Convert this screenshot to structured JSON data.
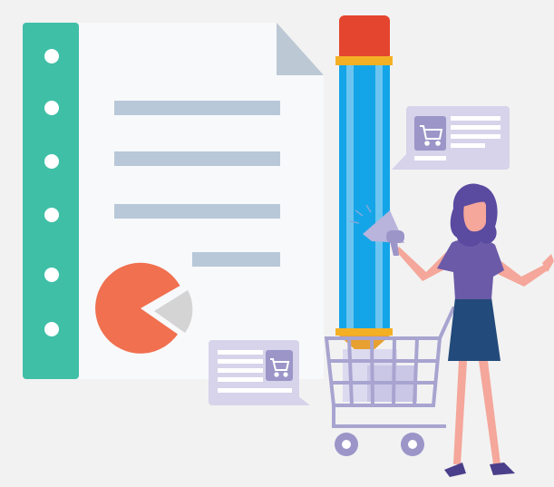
{
  "colors": {
    "background": "#f2f2f2",
    "paper": "#f8f9fb",
    "paper_fold": "#bcc8d4",
    "binder_strip": "#3fbfa6",
    "binder_hole": "#ffffff",
    "text_lines": "#b8c8d8",
    "pie_main": "#f0704f",
    "pie_slice": "#d4d4d4",
    "pencil_eraser": "#e4452f",
    "pencil_band": "#f4b024",
    "pencil_body": "#14a5e8",
    "pencil_stripe": "#6bc5f0",
    "pencil_tip": "#e8a030",
    "bubble": "#d6d3ea",
    "cart_icon_bg": "#9b95c8",
    "cart": "#a8a4d0",
    "woman_top": "#6b5aa8",
    "woman_skirt": "#224a7a",
    "woman_hair": "#5a4aa0",
    "woman_skin": "#f4a79a",
    "megaphone": "#b8b4dc"
  },
  "icons": [
    "cart-icon",
    "megaphone-icon",
    "pie-chart-icon"
  ]
}
